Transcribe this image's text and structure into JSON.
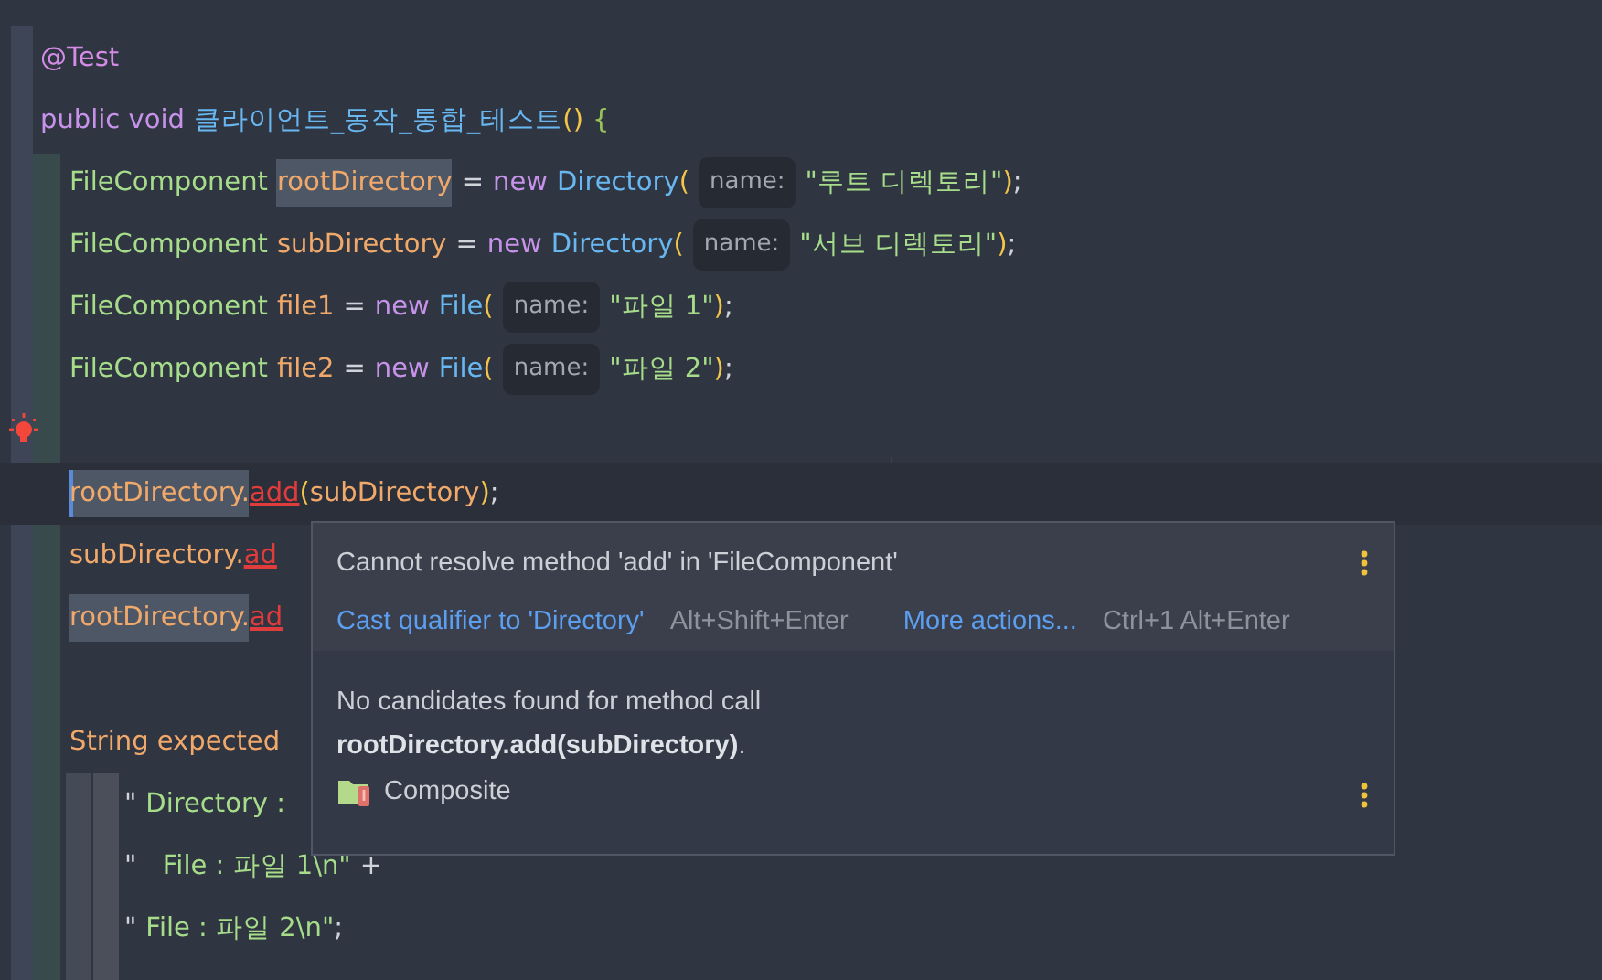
{
  "editor": {
    "lines": [
      {
        "tokens": [
          {
            "kind": "annot",
            "text": "@Test"
          }
        ]
      },
      {
        "tokens": [
          {
            "kind": "keyword",
            "text": "public void"
          },
          {
            "kind": "func",
            "text": "클라이언트_동작_통합_테스트"
          },
          {
            "kind": "close",
            "text": "()"
          },
          {
            "kind": "brace",
            "text": "{"
          }
        ],
        "body": [
          {
            "tokens": [
              {
                "kind": "type",
                "text": "FileComponent"
              },
              {
                "kind": "var-hl",
                "text": "rootDirectory"
              },
              {
                "kind": "plain",
                "text": "="
              },
              {
                "kind": "keyword",
                "text": "new"
              },
              {
                "kind": "func",
                "text": "Directory"
              },
              {
                "kind": "open",
                "text": "("
              },
              {
                "kind": "hint",
                "text": "name:"
              },
              {
                "kind": "string",
                "text": "\"루트 디렉토리\""
              },
              {
                "kind": "close",
                "text": ")"
              },
              {
                "kind": "punct",
                "text": ";"
              }
            ]
          },
          {
            "tokens": [
              {
                "kind": "type",
                "text": "FileComponent"
              },
              {
                "kind": "var",
                "text": "subDirectory"
              },
              {
                "kind": "plain",
                "text": "="
              },
              {
                "kind": "keyword",
                "text": "new"
              },
              {
                "kind": "func",
                "text": "Directory"
              },
              {
                "kind": "open",
                "text": "("
              },
              {
                "kind": "hint",
                "text": "name:"
              },
              {
                "kind": "string",
                "text": "\"서브 디렉토리\""
              },
              {
                "kind": "close",
                "text": ")"
              },
              {
                "kind": "punct",
                "text": ";"
              }
            ]
          },
          {
            "tokens": [
              {
                "kind": "type",
                "text": "FileComponent"
              },
              {
                "kind": "var",
                "text": "file1"
              },
              {
                "kind": "plain",
                "text": "="
              },
              {
                "kind": "keyword",
                "text": "new"
              },
              {
                "kind": "func",
                "text": "File"
              },
              {
                "kind": "open",
                "text": "("
              },
              {
                "kind": "hint",
                "text": "name:"
              },
              {
                "kind": "string",
                "text": "\"파일 1\""
              },
              {
                "kind": "close",
                "text": ")"
              },
              {
                "kind": "punct",
                "text": ";"
              }
            ]
          },
          {
            "tokens": [
              {
                "kind": "type",
                "text": "FileComponent"
              },
              {
                "kind": "var",
                "text": "file2"
              },
              {
                "kind": "plain",
                "text": "="
              },
              {
                "kind": "keyword",
                "text": "new"
              },
              {
                "kind": "func",
                "text": "File"
              },
              {
                "kind": "open",
                "text": "("
              },
              {
                "kind": "hint",
                "text": "name:"
              },
              {
                "kind": "string",
                "text": "\"파일 2\""
              },
              {
                "kind": "close",
                "text": ")"
              },
              {
                "kind": "punct",
                "text": ";"
              }
            ]
          },
          {
            "quick_fix": true
          },
          {
            "current": true,
            "tokens": [
              {
                "kind": "var-hl",
                "text": "rootDirectory."
              },
              {
                "kind": "error",
                "text": "add"
              },
              {
                "kind": "open",
                "text": "("
              },
              {
                "kind": "var",
                "text": "subDirectory"
              },
              {
                "kind": "close",
                "text": ")"
              },
              {
                "kind": "punct",
                "text": ";"
              }
            ]
          },
          {
            "tokens": [
              {
                "kind": "var",
                "text": "subDirectory."
              },
              {
                "kind": "error",
                "text": "ad"
              }
            ]
          },
          {
            "tokens": [
              {
                "kind": "var-hl",
                "text": "rootDirectory."
              },
              {
                "kind": "error",
                "text": "ad"
              }
            ]
          },
          {
            "kind": "blank"
          },
          {
            "tokens": [
              {
                "kind": "var",
                "text": "String expected"
              }
            ],
            "children": [
              {
                "tokens": [
                  {
                    "kind": "plain",
                    "text": "\""
                  },
                  {
                    "kind": "string",
                    "text": "Directory :"
                  }
                ]
              },
              {
                "tokens": [
                  {
                    "kind": "plain",
                    "text": "\""
                  },
                  {
                    "kind": "string",
                    "text": "  File : 파일 1\\n\""
                  },
                  {
                    "kind": "plain",
                    "text": "+"
                  }
                ]
              },
              {
                "tokens": [
                  {
                    "kind": "plain",
                    "text": "\""
                  },
                  {
                    "kind": "string",
                    "text": "File : 파일 2\\n\""
                  },
                  {
                    "kind": "punct",
                    "text": ";"
                  }
                ]
              }
            ]
          }
        ]
      }
    ]
  },
  "popup": {
    "title": "Cannot resolve method 'add' in 'FileComponent'",
    "actions": [
      {
        "label": "Cast qualifier to 'Directory'",
        "shortcut": "Alt+Shift+Enter"
      },
      {
        "label": "More actions...",
        "shortcut": "Ctrl+1 Alt+Enter"
      }
    ],
    "description": "No candidates found for method call **rootDirectory.add(subDirectory)**.",
    "module": "Composite"
  }
}
